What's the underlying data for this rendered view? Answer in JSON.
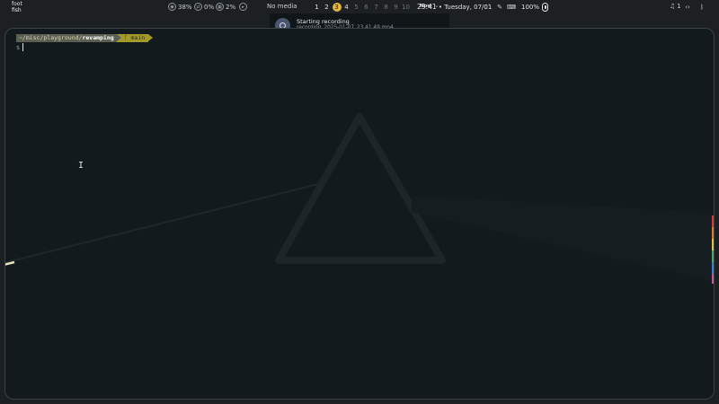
{
  "app": {
    "name": "foot",
    "subtitle": "fish"
  },
  "stats": {
    "cpu": "38%",
    "net": "0%",
    "mem": "2%"
  },
  "media": {
    "label": "No media"
  },
  "workspaces": [
    "1",
    "2",
    "3",
    "4",
    "5",
    "6",
    "7",
    "8",
    "9",
    "10"
  ],
  "active_workspace": "3",
  "clock": {
    "time": "23:41",
    "date": "• Tuesday, 07/01"
  },
  "battery": {
    "percent": "100%"
  },
  "notifications": {
    "count": "1"
  },
  "notification": {
    "title": "Starting recording",
    "body": "recording_2025-01-07_23.41.49.mp4",
    "time": "Now",
    "expand": "⌄"
  },
  "terminal": {
    "cwd_prefix": "~/misc/playground/",
    "cwd_dir": "revamping",
    "git_branch": " main",
    "prompt_symbol": "$"
  },
  "colors": {
    "accent": "#e3b341",
    "terminal_bg": "#121a1d",
    "path_segment": "#5b5f51",
    "git_segment": "#a29a2a"
  },
  "icons": [
    "cpu-icon",
    "network-icon",
    "memory-icon",
    "play-icon",
    "screenshot-icon",
    "pen-icon",
    "keyboard-icon",
    "battery-icon",
    "bell-icon",
    "code-icon",
    "bluetooth-icon",
    "record-icon"
  ]
}
